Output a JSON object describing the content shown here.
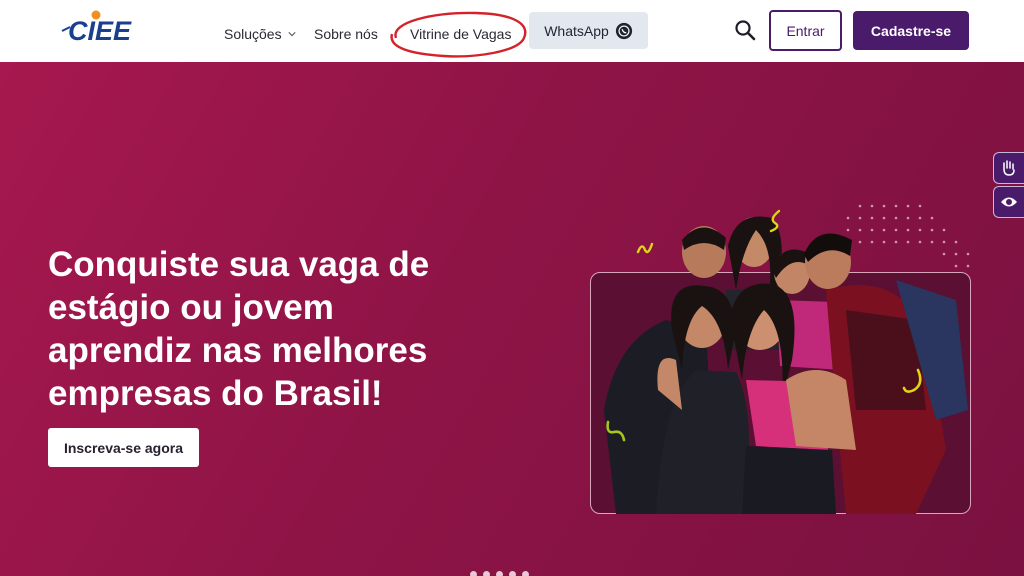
{
  "header": {
    "brand": "CIEE",
    "nav": {
      "solucoes": "Soluções",
      "sobre": "Sobre nós",
      "vitrine": "Vitrine de Vagas"
    },
    "whatsapp_label": "WhatsApp",
    "login_label": "Entrar",
    "signup_label": "Cadastre-se"
  },
  "hero": {
    "headline": "Conquiste sua vaga de estágio ou jovem aprendiz nas melhores empresas do Brasil!",
    "cta_label": "Inscreva-se agora"
  },
  "icons": [
    "ciee-logo",
    "chevron-down-icon",
    "whatsapp-icon",
    "search-icon",
    "sign-language-icon",
    "eye-icon"
  ],
  "colors": {
    "brand_purple": "#4a1a6b",
    "hero_background": "#8e1446",
    "annotation_red": "#d4222b",
    "logo_blue": "#1b3f8f",
    "logo_orange": "#f0901e"
  },
  "carousel": {
    "slides": 5
  }
}
